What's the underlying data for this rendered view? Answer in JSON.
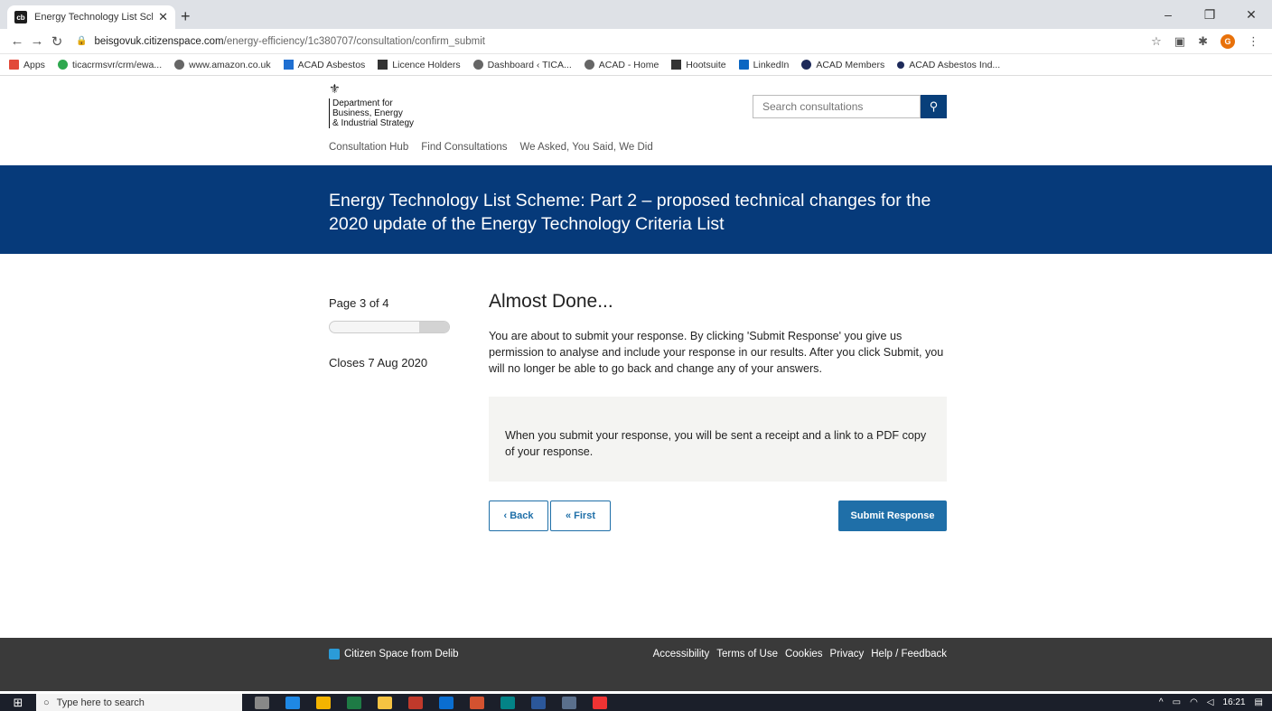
{
  "browser": {
    "tab_title": "Energy Technology List Scheme: ",
    "tab_favicon": "cb",
    "url_host": "beisgovuk.citizenspace.com",
    "url_path": "/energy-efficiency/1c380707/consultation/confirm_submit",
    "profile_initial": "G",
    "bookmarks": [
      "Apps",
      "ticacrmsvr/crm/ewa...",
      "www.amazon.co.uk",
      "ACAD Asbestos",
      "Licence Holders",
      "Dashboard ‹ TICA...",
      "ACAD - Home",
      "Hootsuite",
      "LinkedIn",
      "ACAD Members",
      "ACAD Asbestos Ind..."
    ]
  },
  "header": {
    "logo_lines": [
      "Department for",
      "Business, Energy",
      "& Industrial Strategy"
    ],
    "search_placeholder": "Search consultations",
    "nav": [
      "Consultation Hub",
      "Find Consultations",
      "We Asked, You Said, We Did"
    ]
  },
  "banner": {
    "title": "Energy Technology List Scheme: Part 2 – proposed technical changes for the 2020 update of the Energy Technology Criteria List"
  },
  "sidebar": {
    "page_label": "Page 3 of 4",
    "progress_fraction": 0.75,
    "closes": "Closes 7 Aug 2020"
  },
  "main": {
    "heading": "Almost Done...",
    "intro": "You are about to submit your response. By clicking 'Submit Response' you give us permission to analyse and include your response in our results. After you click Submit, you will no longer be able to go back and change any of your answers.",
    "info": "When you submit your response, you will be sent a receipt and a link to a PDF copy of your response.",
    "back_label": "‹ Back",
    "first_label": "« First",
    "submit_label": "Submit Response"
  },
  "footer": {
    "brand": "Citizen Space from Delib",
    "links": [
      "Accessibility",
      "Terms of Use",
      "Cookies",
      "Privacy",
      "Help / Feedback"
    ]
  },
  "taskbar": {
    "search_placeholder": "Type here to search",
    "time": "16:21"
  }
}
